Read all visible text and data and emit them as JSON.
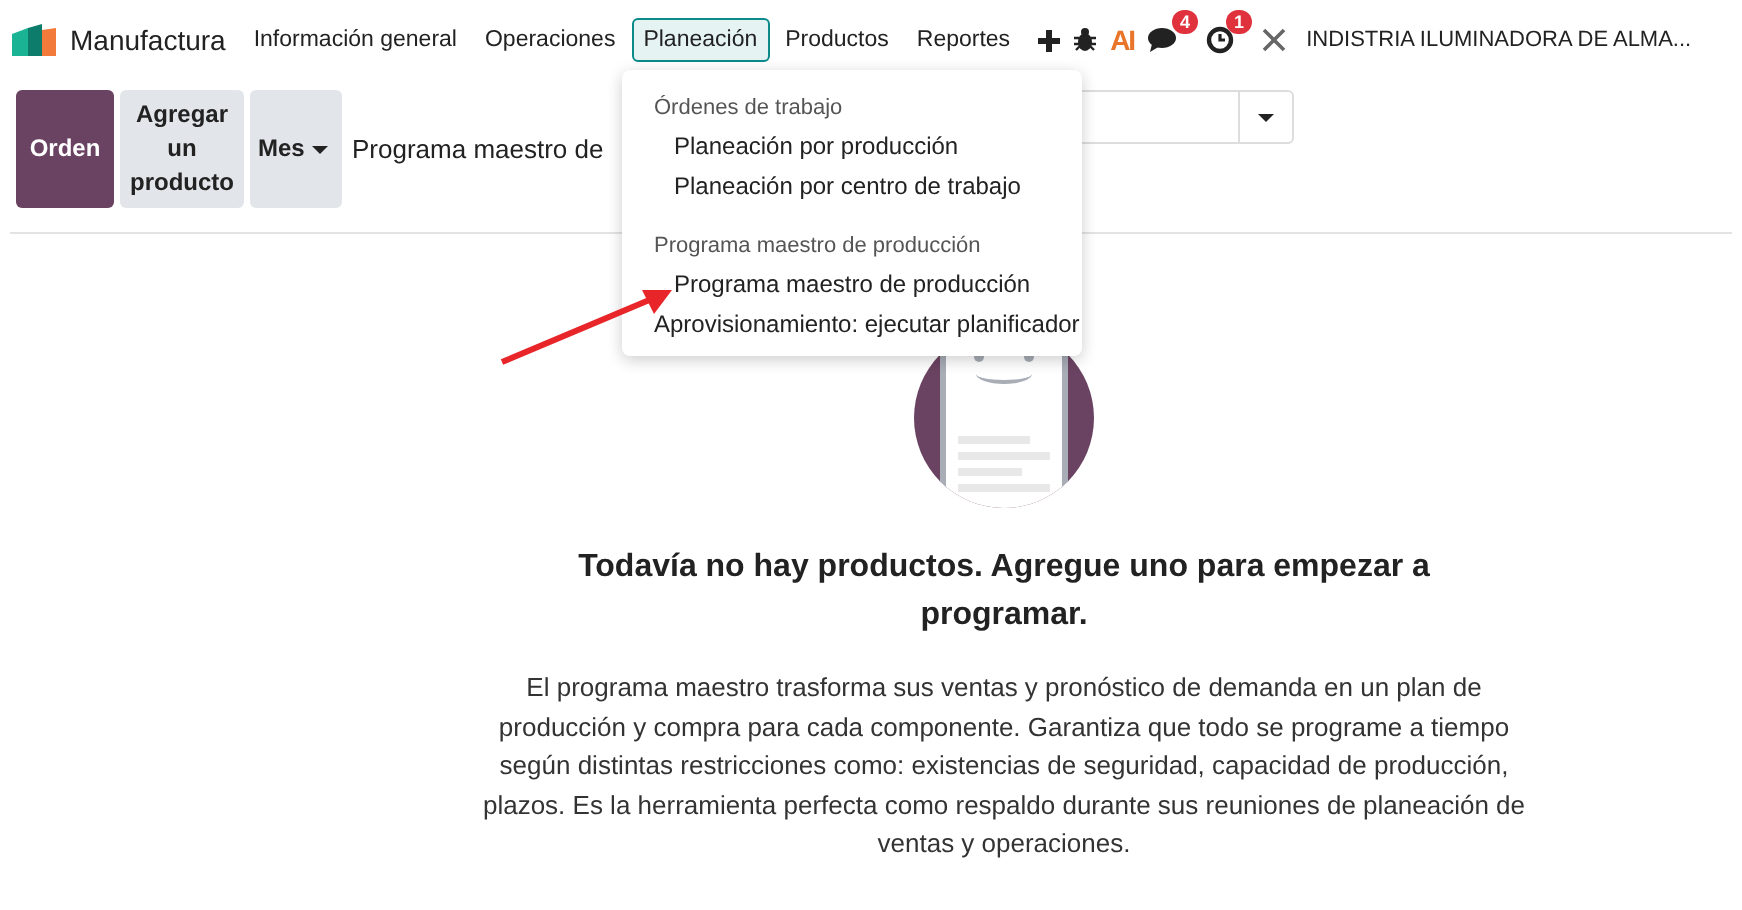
{
  "app_name": "Manufactura",
  "nav": [
    {
      "label": "Información general",
      "selected": false
    },
    {
      "label": "Operaciones",
      "selected": false
    },
    {
      "label": "Planeación",
      "selected": true
    },
    {
      "label": "Productos",
      "selected": false
    },
    {
      "label": "Reportes",
      "selected": false
    }
  ],
  "systray": {
    "ai_label": "AI",
    "messages_badge": "4",
    "activities_badge": "1",
    "company": "INDISTRIA ILUMINADORA DE ALMA..."
  },
  "control_panel": {
    "buttons": [
      {
        "label": "Orden",
        "kind": "primary"
      },
      {
        "label": "Agregar un producto",
        "kind": "secondary"
      }
    ],
    "period_button": "Mes",
    "title": "Programa maestro de"
  },
  "dropdown": [
    {
      "label": "Órdenes de trabajo",
      "kind": "header"
    },
    {
      "label": "Planeación por producción",
      "kind": "subitem"
    },
    {
      "label": "Planeación por centro de trabajo",
      "kind": "subitem"
    },
    {
      "label": "Programa maestro de producción",
      "kind": "header"
    },
    {
      "label": "Programa maestro de producción",
      "kind": "subitem"
    },
    {
      "label": "Aprovisionamiento: ejecutar planificador",
      "kind": "item"
    }
  ],
  "empty_state": {
    "title": "Todavía no hay productos. Agregue uno para empezar a programar.",
    "text": "El programa maestro trasforma sus ventas y pronóstico de demanda en un plan de producción y compra para cada componente. Garantiza que todo se programe a tiempo según distintas restricciones como: existencias de seguridad, capacidad de producción, plazos. Es la herramienta perfecta como respaldo durante sus reuniones de planeación de ventas y operaciones."
  }
}
